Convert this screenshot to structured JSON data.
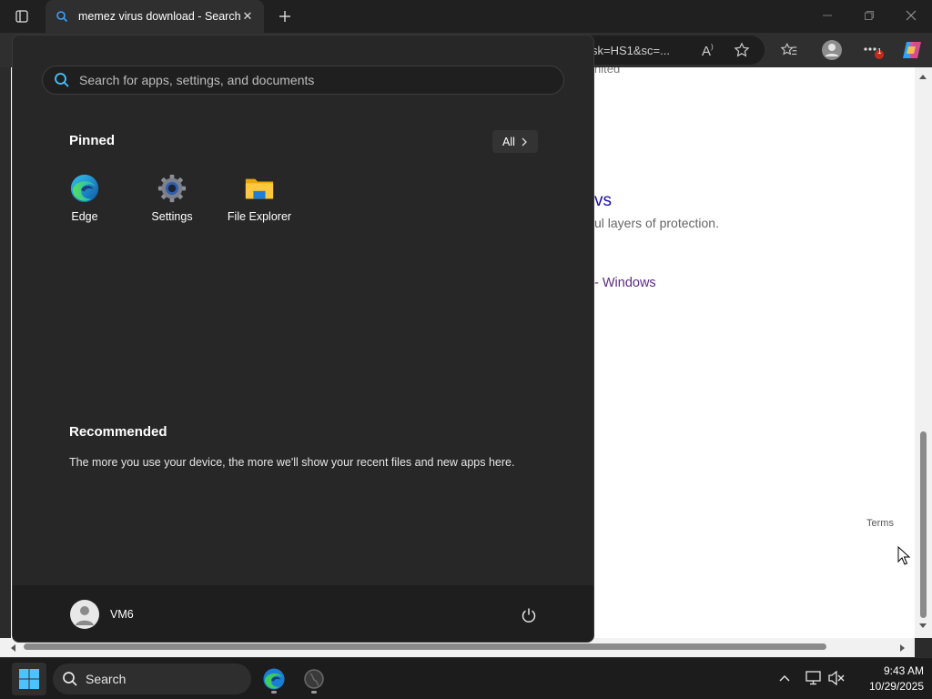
{
  "browser": {
    "tab_title": "memez virus download - Search",
    "address_fragment": "sk=HS1&sc=...",
    "notification_count": "1"
  },
  "page": {
    "fragment_top": "nited",
    "heading_fragment": "vs",
    "desc_fragment": "ul layers of protection.",
    "link_fragment": "- Windows",
    "terms_link": "Terms"
  },
  "start_menu": {
    "search_placeholder": "Search for apps, settings, and documents",
    "pinned_title": "Pinned",
    "all_button": "All",
    "pinned_apps": [
      {
        "label": "Edge",
        "icon": "edge-icon"
      },
      {
        "label": "Settings",
        "icon": "settings-gear-icon"
      },
      {
        "label": "File Explorer",
        "icon": "folder-icon"
      }
    ],
    "recommended_title": "Recommended",
    "recommended_text": "The more you use your device, the more we'll show your recent files and new apps here.",
    "user_name": "VM6"
  },
  "taskbar": {
    "search_label": "Search",
    "time": "9:43 AM",
    "date": "10/29/2025"
  },
  "colors": {
    "start_bg": "#272727",
    "link_purple": "#5b2a86",
    "accent_blue": "#0078d4"
  }
}
